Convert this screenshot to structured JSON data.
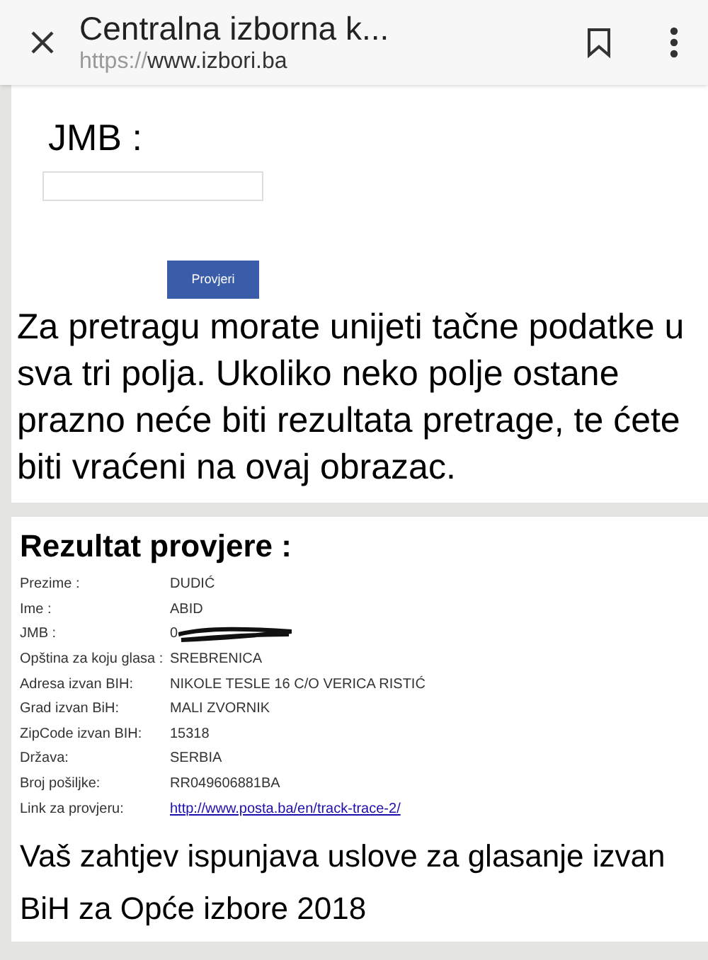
{
  "browser_bar": {
    "title": "Centralna izborna k...",
    "url_scheme": "https://",
    "url_host": "www.izbori.ba"
  },
  "form": {
    "label": "JMB :",
    "button": "Provjeri",
    "notice": "Za pretragu morate unijeti tačne podatke u sva tri polja. Ukoliko neko polje ostane prazno neće biti rezultata pretrage, te ćete biti vraćeni na ovaj obrazac."
  },
  "result": {
    "title": "Rezultat provjere :",
    "rows": [
      {
        "label": "Prezime :",
        "value": "DUDIĆ"
      },
      {
        "label": "Ime :",
        "value": "ABID"
      },
      {
        "label": "JMB :",
        "value": "0",
        "kind": "redacted"
      },
      {
        "label": "Opština za koju glasa :",
        "value": "SREBRENICA"
      },
      {
        "label": "Adresa izvan BIH:",
        "value": "NIKOLE TESLE 16 C/O VERICA RISTIĆ"
      },
      {
        "label": "Grad izvan BiH:",
        "value": "MALI ZVORNIK"
      },
      {
        "label": "ZipCode izvan BIH:",
        "value": "15318"
      },
      {
        "label": "Država:",
        "value": "SERBIA"
      },
      {
        "label": "Broj pošiljke:",
        "value": "RR049606881BA"
      },
      {
        "label": "Link za provjeru:",
        "value": "http://www.posta.ba/en/track-trace-2/",
        "kind": "link"
      }
    ],
    "message": "Vaš zahtjev ispunjava uslove za glasanje izvan BiH za Opće izbore 2018"
  }
}
